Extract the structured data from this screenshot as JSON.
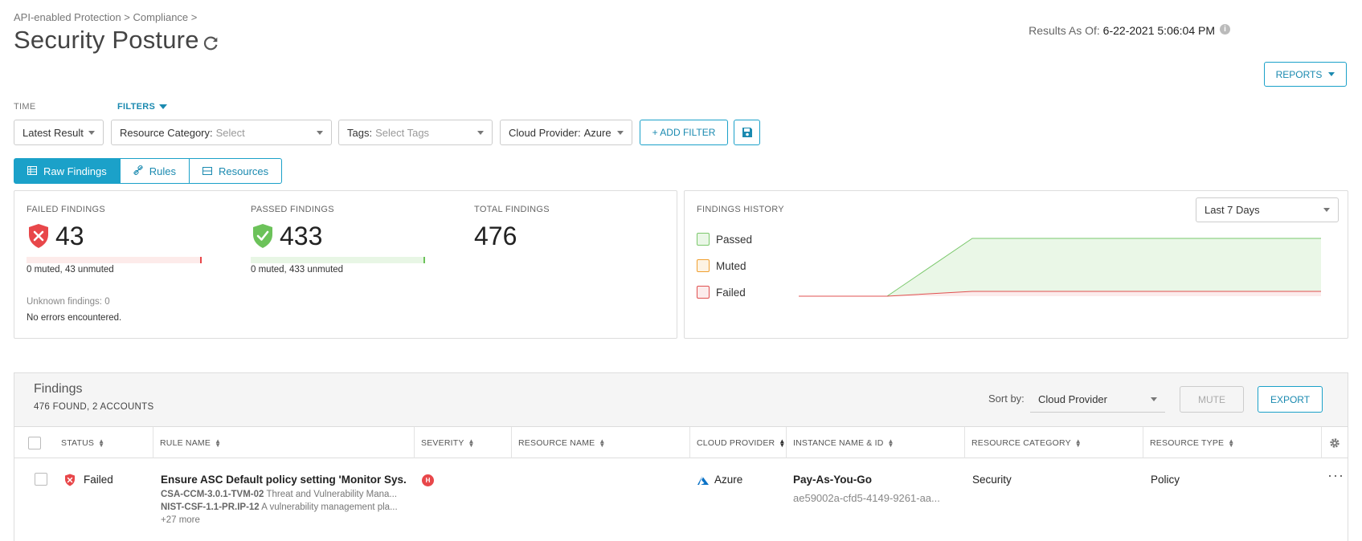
{
  "breadcrumb": "API-enabled Protection > Compliance >",
  "page_title": "Security Posture",
  "results_as_of": {
    "label": "Results As Of:",
    "value": "6-22-2021 5:06:04 PM"
  },
  "reports_label": "REPORTS",
  "filters": {
    "time_label": "TIME",
    "filters_label": "FILTERS",
    "time_value": "Latest Result",
    "resource_category": {
      "label": "Resource Category:",
      "placeholder": "Select"
    },
    "tags": {
      "label": "Tags:",
      "placeholder": "Select Tags"
    },
    "cloud_provider": {
      "label": "Cloud Provider:",
      "value": "Azure"
    },
    "add_filter_label": "+ ADD FILTER"
  },
  "tabs": [
    {
      "label": "Raw Findings",
      "icon": "table-icon",
      "active": true
    },
    {
      "label": "Rules",
      "icon": "link-icon",
      "active": false
    },
    {
      "label": "Resources",
      "icon": "server-icon",
      "active": false
    }
  ],
  "summary": {
    "failed": {
      "label": "FAILED FINDINGS",
      "value": "43",
      "detail": "0 muted, 43 unmuted",
      "color": "#e8474a"
    },
    "passed": {
      "label": "PASSED FINDINGS",
      "value": "433",
      "detail": "0 muted, 433 unmuted",
      "color": "#6cc25a"
    },
    "total": {
      "label": "TOTAL FINDINGS",
      "value": "476"
    },
    "unknown_label": "Unknown findings:",
    "unknown_value": "0",
    "errors_text": "No errors encountered."
  },
  "history": {
    "title": "FINDINGS HISTORY",
    "range": "Last 7 Days",
    "legend": [
      {
        "label": "Passed",
        "color": "#7bc86c",
        "fill": "#eaf7e7"
      },
      {
        "label": "Muted",
        "color": "#f0a030",
        "fill": "#fdf3e3"
      },
      {
        "label": "Failed",
        "color": "#e05050",
        "fill": "#fcecec"
      }
    ]
  },
  "findings": {
    "title": "Findings",
    "count": "476 FOUND, 2 ACCOUNTS",
    "sort_label": "Sort by:",
    "sort_value": "Cloud Provider",
    "mute_label": "MUTE",
    "export_label": "EXPORT",
    "columns": [
      "STATUS",
      "RULE NAME",
      "SEVERITY",
      "RESOURCE NAME",
      "CLOUD PROVIDER",
      "INSTANCE NAME & ID",
      "RESOURCE CATEGORY",
      "RESOURCE TYPE"
    ],
    "row": {
      "status": "Failed",
      "rule_name": "Ensure ASC Default policy setting 'Monitor Sys...",
      "rule_sub1_code": "CSA-CCM-3.0.1-TVM-02",
      "rule_sub1_text": "Threat and Vulnerability Mana...",
      "rule_sub2_code": "NIST-CSF-1.1-PR.IP-12",
      "rule_sub2_text": "A vulnerability management pla...",
      "rule_more": "+27 more",
      "severity": "H",
      "cloud_provider": "Azure",
      "instance_name": "Pay-As-You-Go",
      "instance_id": "ae59002a-cfd5-4149-9261-aa...",
      "resource_category": "Security",
      "resource_type": "Policy"
    }
  }
}
